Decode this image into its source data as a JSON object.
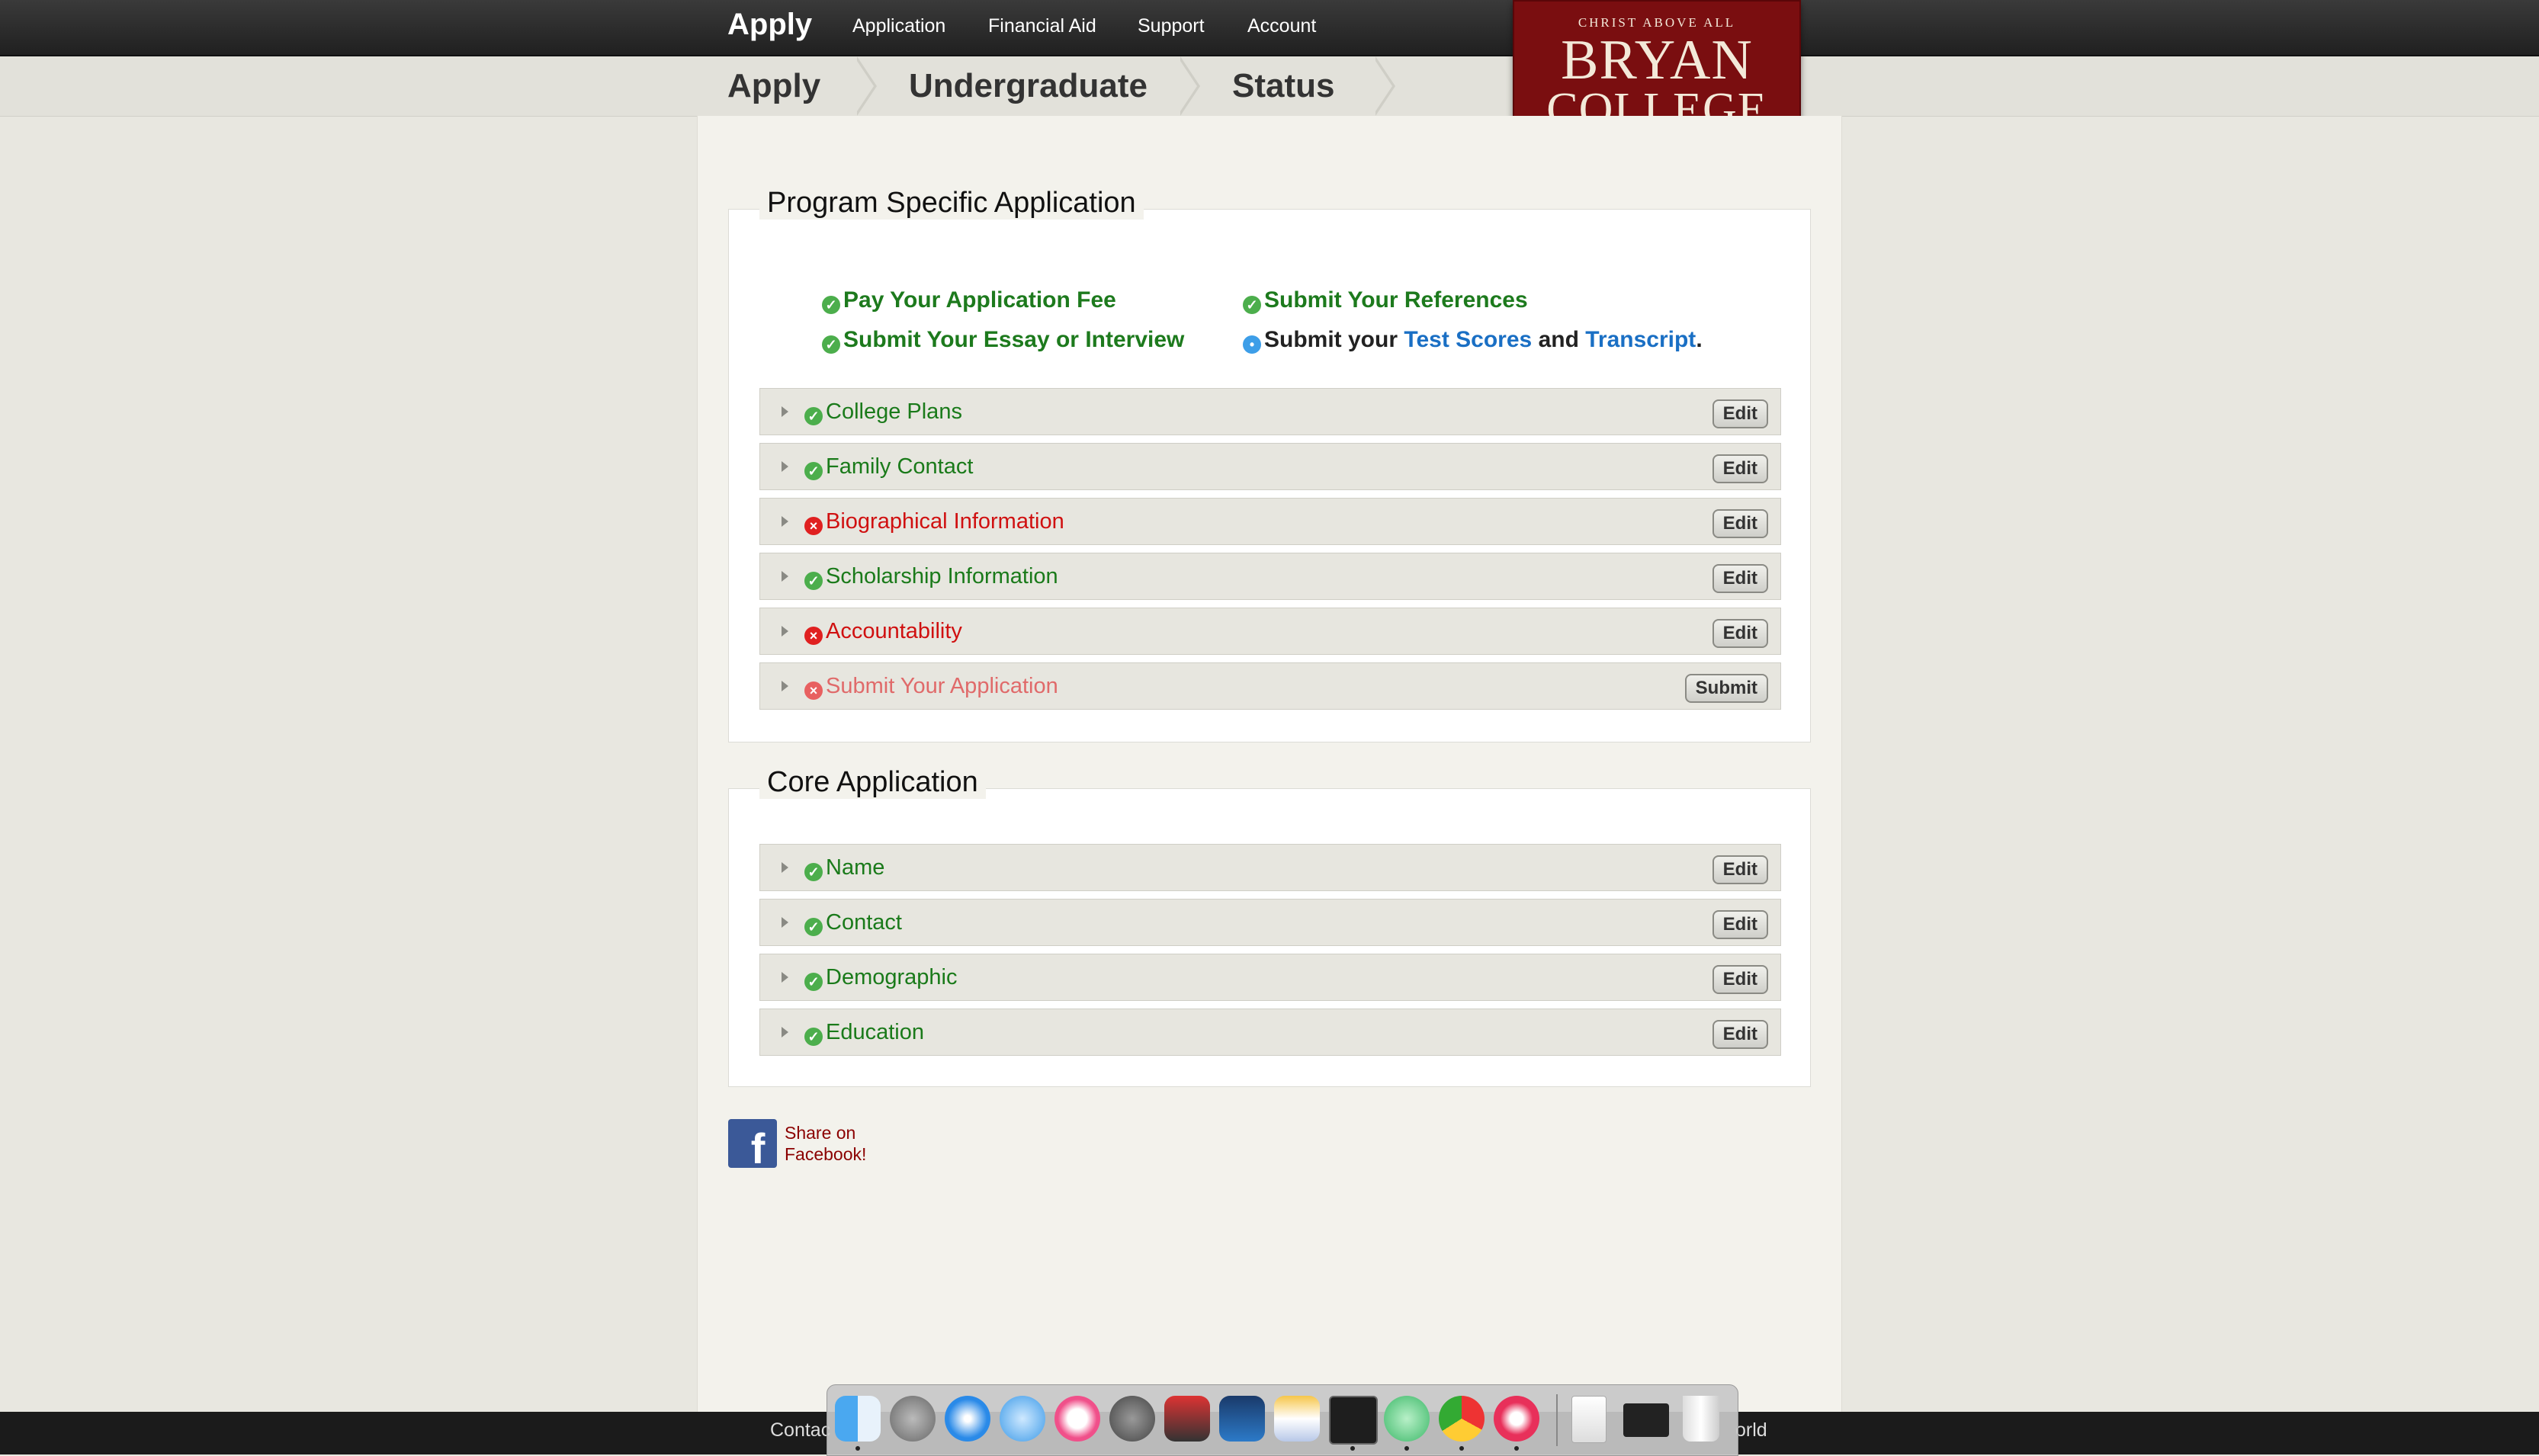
{
  "nav": {
    "brand": "Apply",
    "links": [
      "Application",
      "Financial Aid",
      "Support",
      "Account"
    ]
  },
  "breadcrumb": [
    "Apply",
    "Undergraduate",
    "Status"
  ],
  "logo": {
    "motto": "CHRIST ABOVE ALL",
    "line1": "BRYAN",
    "line2": "COLLEGE"
  },
  "program": {
    "title": "Program Specific Application",
    "tasks": {
      "fee": "Pay Your Application Fee",
      "references": "Submit Your References",
      "essay": "Submit Your Essay or Interview",
      "scores_prefix": "Submit your",
      "test_scores": "Test Scores",
      "and": "and",
      "transcript": "Transcript",
      "period": "."
    },
    "rows": [
      {
        "label": "College Plans",
        "status": "complete",
        "button": "Edit"
      },
      {
        "label": "Family Contact",
        "status": "complete",
        "button": "Edit"
      },
      {
        "label": "Biographical Information",
        "status": "incomplete",
        "button": "Edit"
      },
      {
        "label": "Scholarship Information",
        "status": "complete",
        "button": "Edit"
      },
      {
        "label": "Accountability",
        "status": "incomplete",
        "button": "Edit"
      },
      {
        "label": "Submit Your Application",
        "status": "disabled",
        "button": "Submit"
      }
    ]
  },
  "core": {
    "title": "Core Application",
    "rows": [
      {
        "label": "Name",
        "status": "complete",
        "button": "Edit"
      },
      {
        "label": "Contact",
        "status": "complete",
        "button": "Edit"
      },
      {
        "label": "Demographic",
        "status": "complete",
        "button": "Edit"
      },
      {
        "label": "Education",
        "status": "complete",
        "button": "Edit"
      }
    ]
  },
  "share": {
    "line1": "Share on",
    "line2": "Facebook!"
  },
  "footer": {
    "left": "Contac",
    "right": "orld"
  },
  "colors": {
    "complete": "#1a7a1a",
    "incomplete": "#d01010",
    "link": "#1a6fc4",
    "logo_bg": "#7a0e10"
  }
}
